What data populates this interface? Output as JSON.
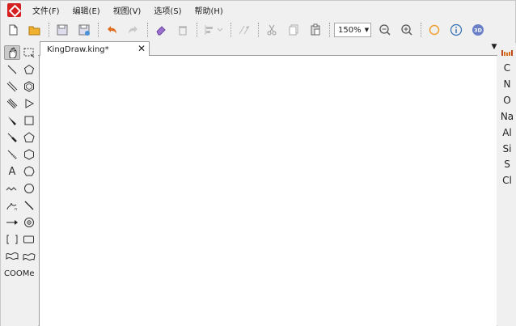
{
  "menu": {
    "items": [
      "文件(F)",
      "编辑(E)",
      "视图(V)",
      "选项(S)",
      "帮助(H)"
    ]
  },
  "toolbar": {
    "zoom_value": "150%"
  },
  "tab": {
    "title": "KingDraw.king*",
    "close_label": "✕"
  },
  "left_tools": {
    "text_tool_label": "A",
    "template_label": "COOMe"
  },
  "right_elements": [
    "C",
    "N",
    "O",
    "Na",
    "Al",
    "Si",
    "S",
    "Cl"
  ],
  "colors": {
    "brand": "#d42020",
    "accent": "#e07020",
    "info": "#2f6fb5"
  }
}
